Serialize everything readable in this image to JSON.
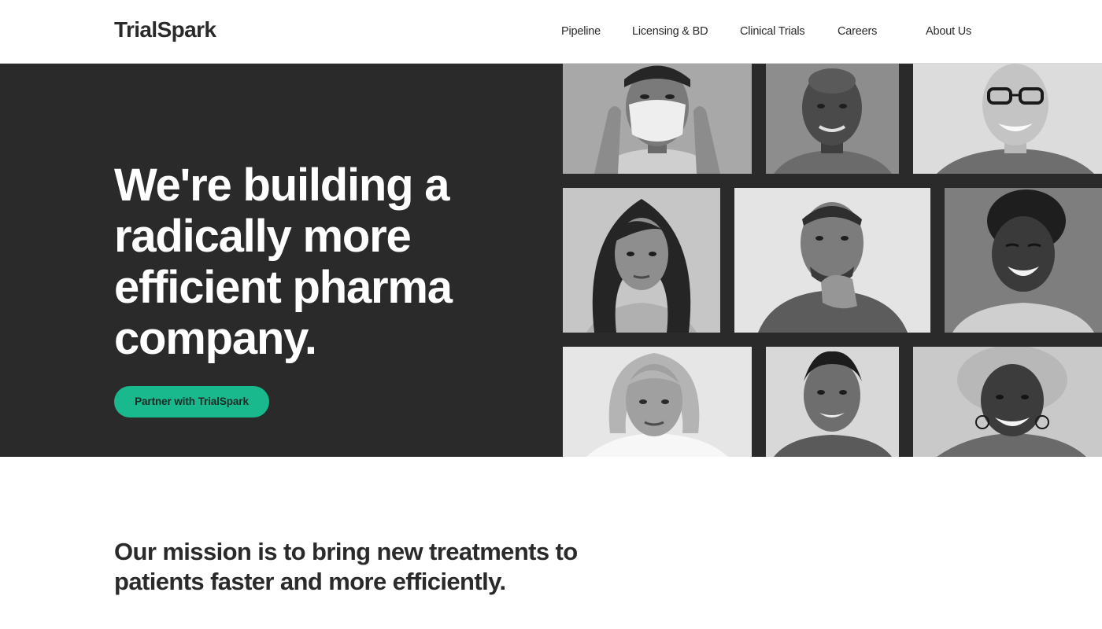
{
  "brand": {
    "logo_text": "TrialSpark",
    "accent_color": "#19b98d",
    "dark_color": "#2a2a2a"
  },
  "nav": {
    "items": [
      {
        "label": "Pipeline"
      },
      {
        "label": "Licensing & BD"
      },
      {
        "label": "Clinical Trials"
      },
      {
        "label": "Careers"
      },
      {
        "label": "About Us"
      }
    ]
  },
  "hero": {
    "title": "We're building a radically more efficient pharma company.",
    "cta_label": "Partner with TrialSpark"
  },
  "photos": [
    {
      "name": "portrait-man-putting-on-mask"
    },
    {
      "name": "portrait-bald-man-smiling"
    },
    {
      "name": "portrait-smiling-person-glasses"
    },
    {
      "name": "portrait-woman-long-hair"
    },
    {
      "name": "portrait-man-hand-on-chin"
    },
    {
      "name": "portrait-woman-laughing"
    },
    {
      "name": "portrait-woman-short-hair"
    },
    {
      "name": "portrait-man-smiling"
    },
    {
      "name": "portrait-woman-curly-hair"
    }
  ],
  "mission": {
    "text": "Our mission is to bring new treatments to patients faster and more efficiently."
  }
}
